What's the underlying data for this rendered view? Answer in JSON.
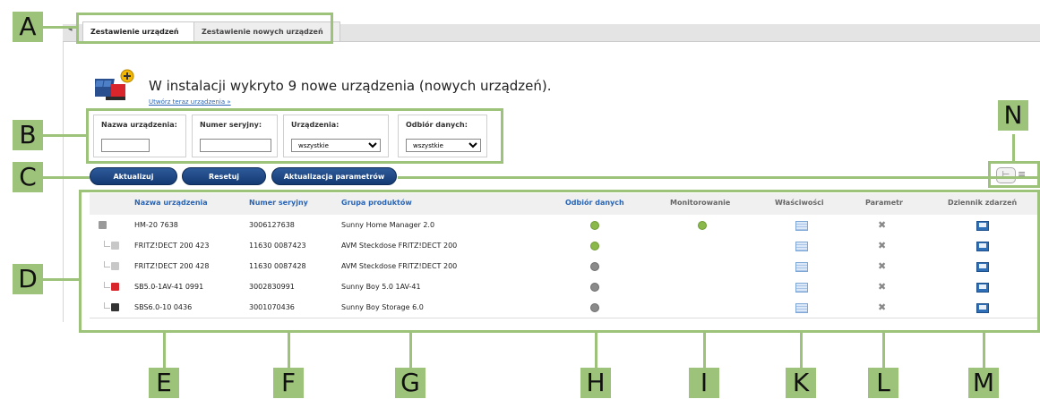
{
  "callouts": {
    "A": "A",
    "B": "B",
    "C": "C",
    "D": "D",
    "E": "E",
    "F": "F",
    "G": "G",
    "H": "H",
    "I": "I",
    "K": "K",
    "L": "L",
    "M": "M",
    "N": "N"
  },
  "tabs": [
    {
      "label": "Zestawienie urządzeń"
    },
    {
      "label": "Zestawienie nowych urządzeń"
    }
  ],
  "notice": {
    "message": "W instalacji wykryto 9 nowe urządzenia (nowych urządzeń).",
    "link": "Utwórz teraz urządzenia »"
  },
  "filters": {
    "name_label": "Nazwa urządzenia:",
    "name_value": "",
    "serial_label": "Numer seryjny:",
    "serial_value": "",
    "devices_label": "Urządzenia:",
    "devices_value": "wszystkie",
    "data_label": "Odbiór danych:",
    "data_value": "wszystkie"
  },
  "buttons": {
    "refresh": "Aktualizuj",
    "reset": "Resetuj",
    "update_params": "Aktualizacja parametrów"
  },
  "table": {
    "headers": {
      "name": "Nazwa urządzenia",
      "serial": "Numer seryjny",
      "group": "Grupa produktów",
      "data": "Odbiór danych",
      "monitoring": "Monitorowanie",
      "properties": "Właściwości",
      "parameter": "Parametr",
      "log": "Dziennik zdarzeń"
    },
    "rows": [
      {
        "name": "HM-20 7638",
        "serial": "3006127638",
        "group": "Sunny Home Manager 2.0",
        "data_status": "green",
        "monitoring_status": "green",
        "icon": "home-manager-icon"
      },
      {
        "name": "FRITZ!DECT 200 423",
        "serial": "11630 0087423",
        "group": "AVM Steckdose FRITZ!DECT 200",
        "data_status": "green",
        "monitoring_status": "",
        "icon": "socket-icon"
      },
      {
        "name": "FRITZ!DECT 200 428",
        "serial": "11630 0087428",
        "group": "AVM Steckdose FRITZ!DECT 200",
        "data_status": "grey",
        "monitoring_status": "",
        "icon": "socket-icon"
      },
      {
        "name": "SB5.0-1AV-41 0991",
        "serial": "3002830991",
        "group": "Sunny Boy 5.0 1AV-41",
        "data_status": "grey",
        "monitoring_status": "",
        "icon": "inverter-icon"
      },
      {
        "name": "SBS6.0-10 0436",
        "serial": "3001070436",
        "group": "Sunny Boy Storage 6.0",
        "data_status": "grey",
        "monitoring_status": "",
        "icon": "storage-inverter-icon"
      }
    ]
  },
  "colors": {
    "callout": "#9dc27a",
    "link": "#2a64b4",
    "button": "#1d477f",
    "status_green": "#8ab84a",
    "status_grey": "#8a8a8a"
  }
}
